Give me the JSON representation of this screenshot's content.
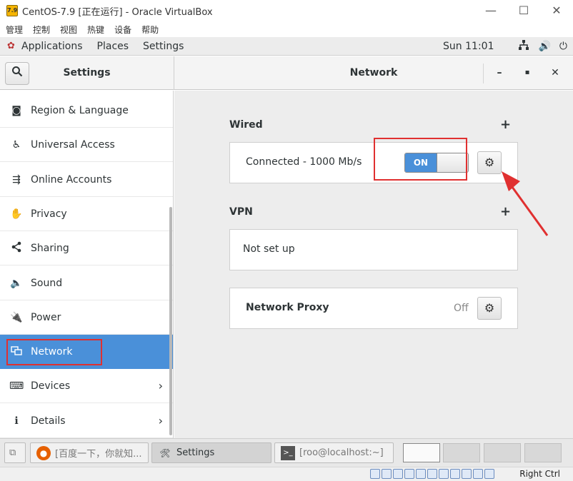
{
  "vbox": {
    "title": "CentOS-7.9 [正在运行] - Oracle VirtualBox",
    "menu": [
      "管理",
      "控制",
      "视图",
      "热键",
      "设备",
      "帮助"
    ],
    "win_min": "—",
    "win_max": "☐",
    "win_close": "✕",
    "host_key": "Right Ctrl"
  },
  "topbar": {
    "applications": "Applications",
    "places": "Places",
    "settings": "Settings",
    "clock": "Sun 11:01"
  },
  "header": {
    "left_title": "Settings",
    "right_title": "Network",
    "minimize": "–",
    "maximize": "▪",
    "close": "✕"
  },
  "sidebar": {
    "items": [
      {
        "label": "Region & Language",
        "icon": "region-icon"
      },
      {
        "label": "Universal Access",
        "icon": "accessibility-icon"
      },
      {
        "label": "Online Accounts",
        "icon": "online-accounts-icon"
      },
      {
        "label": "Privacy",
        "icon": "privacy-hand-icon"
      },
      {
        "label": "Sharing",
        "icon": "share-icon"
      },
      {
        "label": "Sound",
        "icon": "speaker-icon"
      },
      {
        "label": "Power",
        "icon": "power-plug-icon"
      },
      {
        "label": "Network",
        "icon": "network-icon",
        "active": true
      },
      {
        "label": "Devices",
        "icon": "devices-icon",
        "has_submenu": true
      },
      {
        "label": "Details",
        "icon": "info-icon",
        "has_submenu": true
      }
    ]
  },
  "main": {
    "wired": {
      "title": "Wired",
      "add": "+",
      "status": "Connected - 1000 Mb/s",
      "toggle_label": "ON"
    },
    "vpn": {
      "title": "VPN",
      "add": "+",
      "status": "Not set up"
    },
    "proxy": {
      "title": "Network Proxy",
      "state": "Off"
    }
  },
  "taskbar": {
    "items": [
      {
        "label": "[百度一下，你就知...",
        "icon": "firefox-icon",
        "active": false
      },
      {
        "label": "Settings",
        "icon": "settings-tools-icon",
        "active": true
      },
      {
        "label": "[roo@localhost:~]",
        "icon": "terminal-icon",
        "active": false
      }
    ]
  },
  "colors": {
    "accent": "#4a90d9",
    "annotation": "#e03030"
  }
}
